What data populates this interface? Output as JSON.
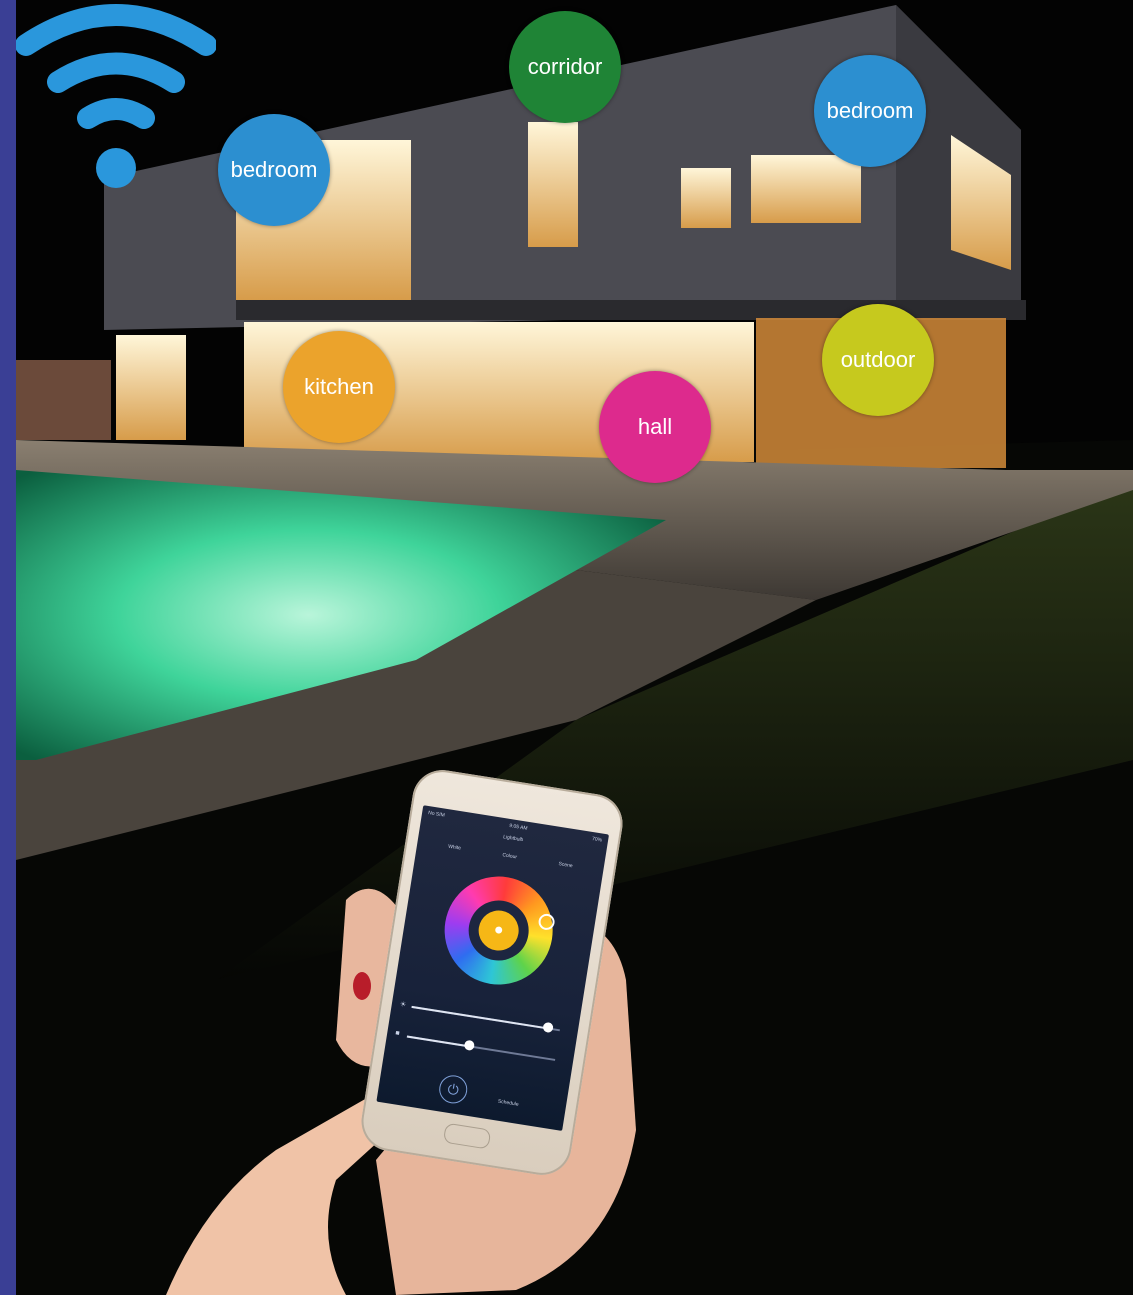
{
  "rooms": [
    {
      "id": "bedroom-left",
      "label": "bedroom",
      "color": "#2c8fd0"
    },
    {
      "id": "corridor",
      "label": "corridor",
      "color": "#1f8436"
    },
    {
      "id": "bedroom-right",
      "label": "bedroom",
      "color": "#2c8fd0"
    },
    {
      "id": "kitchen",
      "label": "kitchen",
      "color": "#eba32c"
    },
    {
      "id": "hall",
      "label": "hall",
      "color": "#dd2a8d"
    },
    {
      "id": "outdoor",
      "label": "outdoor",
      "color": "#c6c91e"
    }
  ],
  "wifi": {
    "icon": "wifi-icon",
    "color": "#2a97dc"
  },
  "phone": {
    "status_left": "No SIM",
    "status_center": "9:05 AM",
    "status_right": "70%",
    "title": "Lightbulb",
    "tabs": [
      "White",
      "Colour",
      "Scene"
    ],
    "brightness_level": 0.92,
    "temperature_level": 0.42,
    "power_icon": "power-icon",
    "timer_label": "Schedule"
  },
  "colors": {
    "accent_bar": "#3a3f95",
    "pool_glow": "#3fd49a",
    "window_light": "#ffe9b8"
  }
}
